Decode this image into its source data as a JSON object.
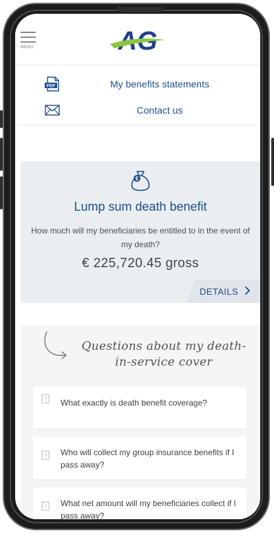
{
  "header": {
    "menu_label": "MENU",
    "logo_text": "AG"
  },
  "links": [
    {
      "label": "My benefits statements",
      "icon": "pdf-icon"
    },
    {
      "label": "Contact us",
      "icon": "envelope-icon"
    }
  ],
  "benefit": {
    "icon": "money-bag-icon",
    "title": "Lump sum death benefit",
    "description": "How much will my beneficiaries be entitled to in the event of my death?",
    "amount": "€ 225,720.45 gross",
    "details_label": "DETAILS"
  },
  "faq": {
    "heading_line1": "Questions about my death-",
    "heading_line2": "in-service cover",
    "items": [
      {
        "question": "What exactly is death benefit coverage?"
      },
      {
        "question": "Who will collect my group insurance benefits if I pass away?"
      },
      {
        "question": "What net amount will my beneficiaries collect if I pass away?"
      }
    ]
  },
  "colors": {
    "accent_blue": "#1f4e8c",
    "logo_navy": "#1d3f8f",
    "logo_green": "#8cc63f",
    "card_bg": "#eaeef1"
  }
}
